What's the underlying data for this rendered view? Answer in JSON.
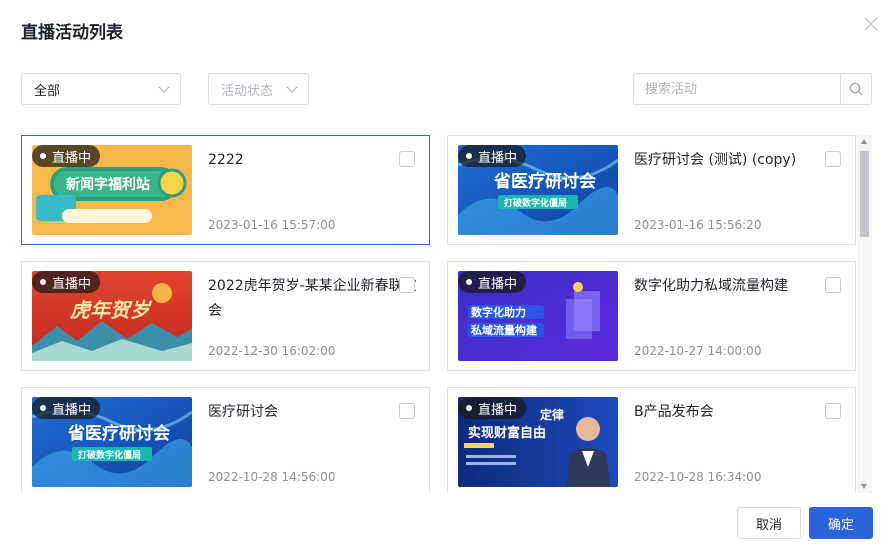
{
  "dialog": {
    "title": "直播活动列表"
  },
  "filters": {
    "category": "全部",
    "status_placeholder": "活动状态"
  },
  "search": {
    "placeholder": "搜索活动"
  },
  "cards": [
    {
      "badge": "直播中",
      "title": "2222",
      "time": "2023-01-16 15:57:00",
      "thumb_text": "新闻字福利站",
      "thumb_sub": "",
      "selected": true
    },
    {
      "badge": "直播中",
      "title": "医疗研讨会 (测试) (copy)",
      "time": "2023-01-16 15:56:20",
      "thumb_text": "省医疗研讨会",
      "thumb_sub": "打破数字化僵局",
      "selected": false
    },
    {
      "badge": "直播中",
      "title": "2022虎年贺岁-某某企业新春联欢会",
      "time": "2022-12-30 16:02:00",
      "thumb_text": "虎年贺岁",
      "thumb_sub": "",
      "selected": false
    },
    {
      "badge": "直播中",
      "title": "数字化助力私域流量构建",
      "time": "2022-10-27 14:00:00",
      "thumb_text": "数字化助力",
      "thumb_sub": "私域流量构建",
      "selected": false
    },
    {
      "badge": "直播中",
      "title": "医疗研讨会",
      "time": "2022-10-28 14:56:00",
      "thumb_text": "省医疗研讨会",
      "thumb_sub": "打破数字化僵局",
      "selected": false
    },
    {
      "badge": "直播中",
      "title": "B产品发布会",
      "time": "2022-10-28 16:34:00",
      "thumb_text": "实现财富自由",
      "thumb_sub": "定律",
      "selected": false
    }
  ],
  "footer": {
    "cancel_label": "取消",
    "ok_label": "确定"
  },
  "colors": {
    "primary": "#2a64d8",
    "border": "#dcdfe6"
  }
}
